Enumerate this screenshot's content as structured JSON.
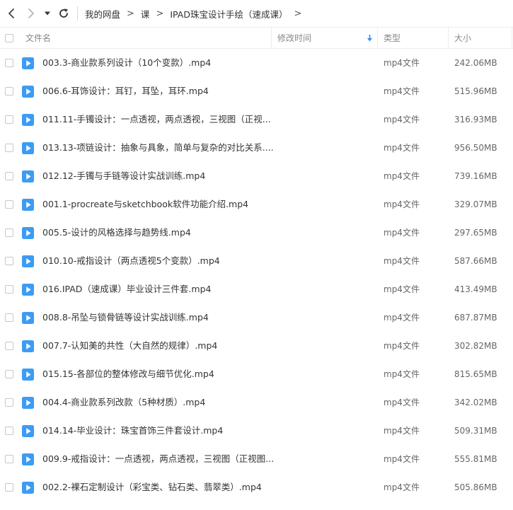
{
  "toolbar": {
    "back_icon": "chevron-left-icon",
    "forward_icon": "chevron-right-icon",
    "menu_icon": "caret-down-icon",
    "refresh_icon": "refresh-icon"
  },
  "breadcrumb": {
    "items": [
      "我的网盘",
      "课",
      "IPAD珠宝设计手绘（速成课）"
    ],
    "separator": ">"
  },
  "table": {
    "headers": {
      "name": "文件名",
      "modified": "修改时间",
      "type": "类型",
      "size": "大小"
    },
    "sort_icon": "arrow-down-icon",
    "accent_color": "#2f8ff0",
    "files": [
      {
        "name": "003.3-商业款系列设计（10个变款）.mp4",
        "type": "mp4文件",
        "size": "242.06MB"
      },
      {
        "name": "006.6-耳饰设计：耳钉，耳坠，耳环.mp4",
        "type": "mp4文件",
        "size": "515.96MB"
      },
      {
        "name": "011.11-手镯设计：一点透视，两点透视，三视图（正视...",
        "type": "mp4文件",
        "size": "316.93MB"
      },
      {
        "name": "013.13-项链设计：抽象与具象，简单与复杂的对比关系....",
        "type": "mp4文件",
        "size": "956.50MB"
      },
      {
        "name": "012.12-手镯与手链等设计实战训练.mp4",
        "type": "mp4文件",
        "size": "739.16MB"
      },
      {
        "name": "001.1-procreate与sketchbook软件功能介绍.mp4",
        "type": "mp4文件",
        "size": "329.07MB"
      },
      {
        "name": "005.5-设计的风格选择与趋势线.mp4",
        "type": "mp4文件",
        "size": "297.65MB"
      },
      {
        "name": "010.10-戒指设计（两点透视5个变款）.mp4",
        "type": "mp4文件",
        "size": "587.66MB"
      },
      {
        "name": "016.IPAD（速成课）毕业设计三件套.mp4",
        "type": "mp4文件",
        "size": "413.49MB"
      },
      {
        "name": "008.8-吊坠与锁骨链等设计实战训练.mp4",
        "type": "mp4文件",
        "size": "687.87MB"
      },
      {
        "name": "007.7-认知美的共性（大自然的规律）.mp4",
        "type": "mp4文件",
        "size": "302.82MB"
      },
      {
        "name": "015.15-各部位的整体修改与细节优化.mp4",
        "type": "mp4文件",
        "size": "815.65MB"
      },
      {
        "name": "004.4-商业款系列改款（5种材质）.mp4",
        "type": "mp4文件",
        "size": "342.02MB"
      },
      {
        "name": "014.14-毕业设计：珠宝首饰三件套设计.mp4",
        "type": "mp4文件",
        "size": "509.31MB"
      },
      {
        "name": "009.9-戒指设计：一点透视，两点透视，三视图（正视图...",
        "type": "mp4文件",
        "size": "555.81MB"
      },
      {
        "name": "002.2-裸石定制设计（彩宝类、钻石类、翡翠类）.mp4",
        "type": "mp4文件",
        "size": "505.86MB"
      }
    ],
    "file_icon": "video-file-icon"
  }
}
